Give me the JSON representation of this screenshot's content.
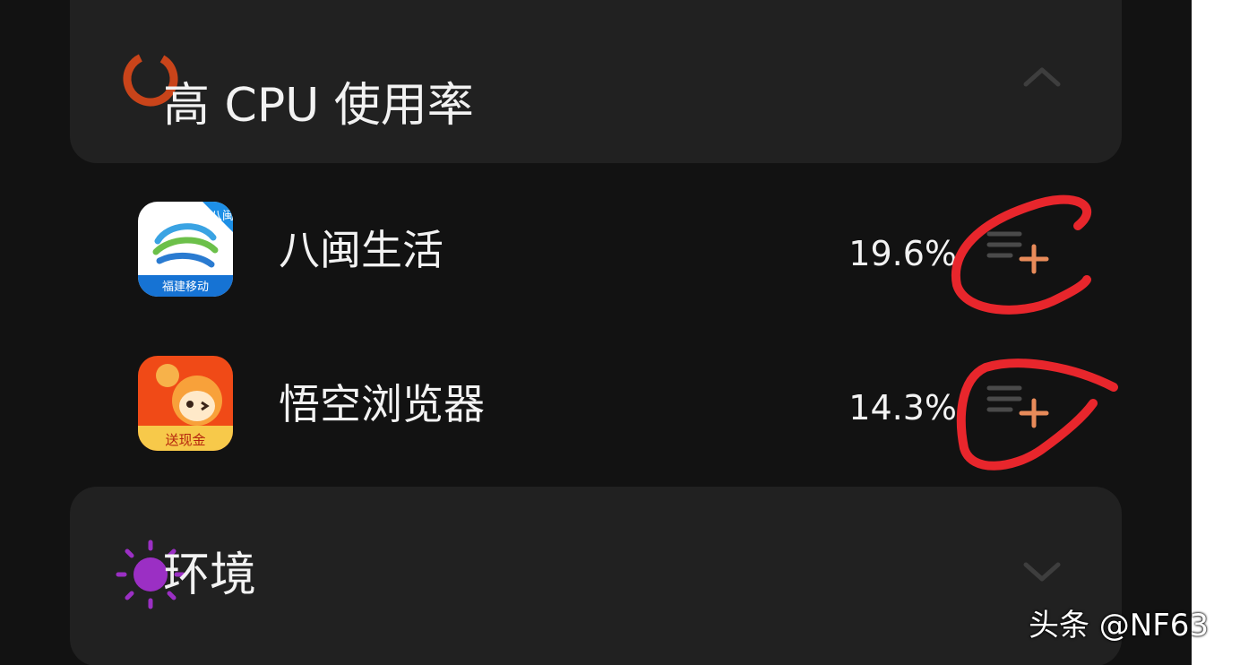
{
  "cpu_section": {
    "title": "高 CPU 使用率",
    "icon": "cpu-ring-icon",
    "expanded": true,
    "accent": "#c9441a",
    "apps": [
      {
        "name": "八闽生活",
        "cpu": "19.6%",
        "icon": "china-mobile-icon",
        "badge_top": "八闽",
        "badge_bottom": "福建移动"
      },
      {
        "name": "悟空浏览器",
        "cpu": "14.3%",
        "icon": "wukong-browser-icon",
        "badge_bottom": "送现金"
      }
    ]
  },
  "env_section": {
    "title": "环境",
    "icon": "sun-icon",
    "expanded": false,
    "accent": "#9b2fc4"
  },
  "watermark": {
    "text": "头条 @NF63"
  },
  "annotation_color": "#e8262c"
}
